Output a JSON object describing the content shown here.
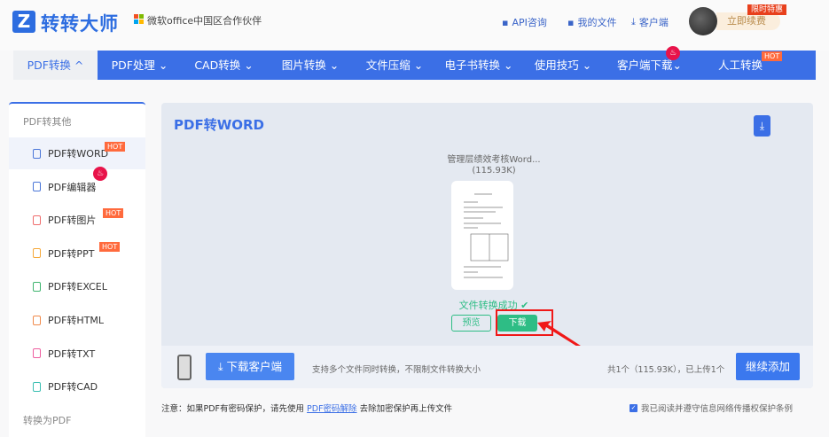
{
  "header": {
    "logo_letter": "Z",
    "logo_text": "转转大师",
    "partner": "微软office中国区合作伙伴",
    "links": [
      {
        "label": "API咨询",
        "icon": "chat-icon"
      },
      {
        "label": "我的文件",
        "icon": "folder-icon"
      },
      {
        "label": "客户端",
        "icon": "download-icon"
      }
    ],
    "renew": "立即续费",
    "promo": "限时特惠"
  },
  "nav": {
    "items": [
      {
        "label": "PDF转换",
        "chev": "^"
      },
      {
        "label": "PDF处理",
        "chev": "⌄"
      },
      {
        "label": "CAD转换",
        "chev": "⌄"
      },
      {
        "label": "图片转换",
        "chev": "⌄"
      },
      {
        "label": "文件压缩",
        "chev": "⌄"
      },
      {
        "label": "电子书转换",
        "chev": "⌄"
      },
      {
        "label": "使用技巧",
        "chev": "⌄"
      },
      {
        "label": "客户端下载",
        "chev": "⌄"
      },
      {
        "label": "人工转换",
        "chev": ""
      }
    ],
    "hot": "HOT"
  },
  "sidebar": {
    "section1": "PDF转其他",
    "section2": "转换为PDF",
    "items": [
      {
        "label": "PDF转WORD",
        "color": "#4a76d8",
        "badge": "HOT"
      },
      {
        "label": "PDF编辑器",
        "color": "#4a76d8",
        "badge": ""
      },
      {
        "label": "PDF转图片",
        "color": "#ef6d6d",
        "badge": "HOT"
      },
      {
        "label": "PDF转PPT",
        "color": "#f5a93a",
        "badge": "HOT"
      },
      {
        "label": "PDF转EXCEL",
        "color": "#3fb56f",
        "badge": ""
      },
      {
        "label": "PDF转HTML",
        "color": "#f08a4b",
        "badge": ""
      },
      {
        "label": "PDF转TXT",
        "color": "#ee5fa0",
        "badge": ""
      },
      {
        "label": "PDF转CAD",
        "color": "#3bbfb2",
        "badge": ""
      }
    ]
  },
  "main": {
    "title": "PDF转WORD",
    "file_name": "管理层绩效考核Word...",
    "file_size": "(115.93K)",
    "status": "文件转换成功",
    "preview": "预览",
    "download": "下载"
  },
  "bottom": {
    "client_button": "下载客户端",
    "support": "支持多个文件同时转换，不限制文件转换大小",
    "count": "共1个（115.93K），已上传1个",
    "add_button": "继续添加"
  },
  "notice": {
    "prefix": "注意：如果PDF有密码保护，请先使用",
    "link": "PDF密码解除",
    "suffix": "去除加密保护再上传文件",
    "agree": "我已阅读并遵守信息网络传播权保护条例",
    "agree_checked": true
  },
  "colors": {
    "primary": "#3b6fe6",
    "success": "#2ebd85",
    "hot": "#ff6a3d"
  }
}
